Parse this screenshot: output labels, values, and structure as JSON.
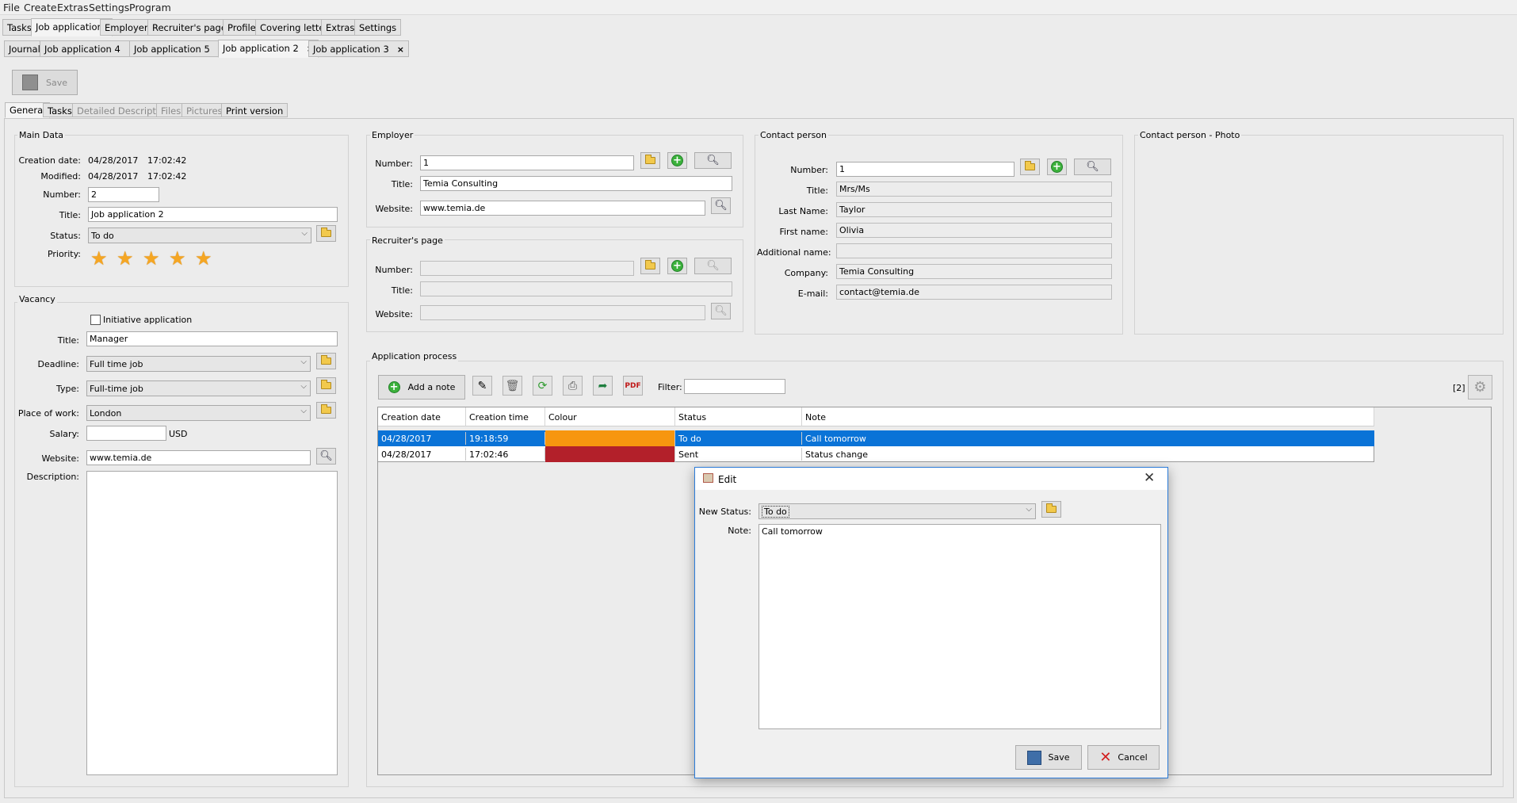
{
  "menu": [
    "File",
    "Create",
    "Extras",
    "Settings",
    "Program"
  ],
  "main_tabs": [
    "Tasks",
    "Job applications",
    "Employers",
    "Recruiter's pages",
    "Profile",
    "Covering letter",
    "Extras",
    "Settings"
  ],
  "doc_tabs": [
    "Journal",
    "Job application 4",
    "Job application 5",
    "Job application 2",
    "Job application 3"
  ],
  "toolbar": {
    "save_label": "Save"
  },
  "sub_tabs": [
    "General",
    "Tasks",
    "Detailed Description",
    "Files",
    "Pictures",
    "Print version"
  ],
  "main_data": {
    "legend": "Main Data",
    "creation_label": "Creation date:",
    "creation_date": "04/28/2017",
    "creation_time": "17:02:42",
    "modified_label": "Modified:",
    "modified_date": "04/28/2017",
    "modified_time": "17:02:42",
    "number_label": "Number:",
    "number": "2",
    "title_label": "Title:",
    "title": "Job application 2",
    "status_label": "Status:",
    "status": "To do",
    "priority_label": "Priority:",
    "priority_stars": 5
  },
  "vacancy": {
    "legend": "Vacancy",
    "initiative_label": "Initiative application",
    "title_label": "Title:",
    "title": "Manager",
    "deadline_label": "Deadline:",
    "deadline": "Full time job",
    "type_label": "Type:",
    "type": "Full-time job",
    "place_label": "Place of work:",
    "place": "London",
    "salary_label": "Salary:",
    "salary": "",
    "currency": "USD",
    "website_label": "Website:",
    "website": "www.temia.de",
    "description_label": "Description:"
  },
  "employer": {
    "legend": "Employer",
    "number_label": "Number:",
    "number": "1",
    "title_label": "Title:",
    "title": "Temia Consulting",
    "website_label": "Website:",
    "website": "www.temia.de"
  },
  "recruiter": {
    "legend": "Recruiter's page",
    "number_label": "Number:",
    "title_label": "Title:",
    "website_label": "Website:"
  },
  "contact": {
    "legend": "Contact person",
    "number_label": "Number:",
    "number": "1",
    "title_label": "Title:",
    "title": "Mrs/Ms",
    "lastname_label": "Last Name:",
    "lastname": "Taylor",
    "firstname_label": "First name:",
    "firstname": "Olivia",
    "additional_label": "Additional name:",
    "additional": "",
    "company_label": "Company:",
    "company": "Temia Consulting",
    "email_label": "E-mail:",
    "email": "contact@temia.de"
  },
  "photo": {
    "legend": "Contact person - Photo"
  },
  "process": {
    "legend": "Application process",
    "add_note": "Add a note",
    "filter_label": "Filter:",
    "count": "[2]",
    "columns": [
      "Creation date",
      "Creation time",
      "Colour",
      "Status",
      "Note"
    ],
    "rows": [
      {
        "date": "04/28/2017",
        "time": "19:18:59",
        "colour": "#f7960f",
        "status": "To do",
        "note": "Call tomorrow"
      },
      {
        "date": "04/28/2017",
        "time": "17:02:46",
        "colour": "#b3202a",
        "status": "Sent",
        "note": "Status change"
      }
    ]
  },
  "dialog": {
    "title": "Edit",
    "status_label": "New Status:",
    "status": "To do",
    "note_label": "Note:",
    "note": "Call tomorrow",
    "save": "Save",
    "cancel": "Cancel"
  }
}
